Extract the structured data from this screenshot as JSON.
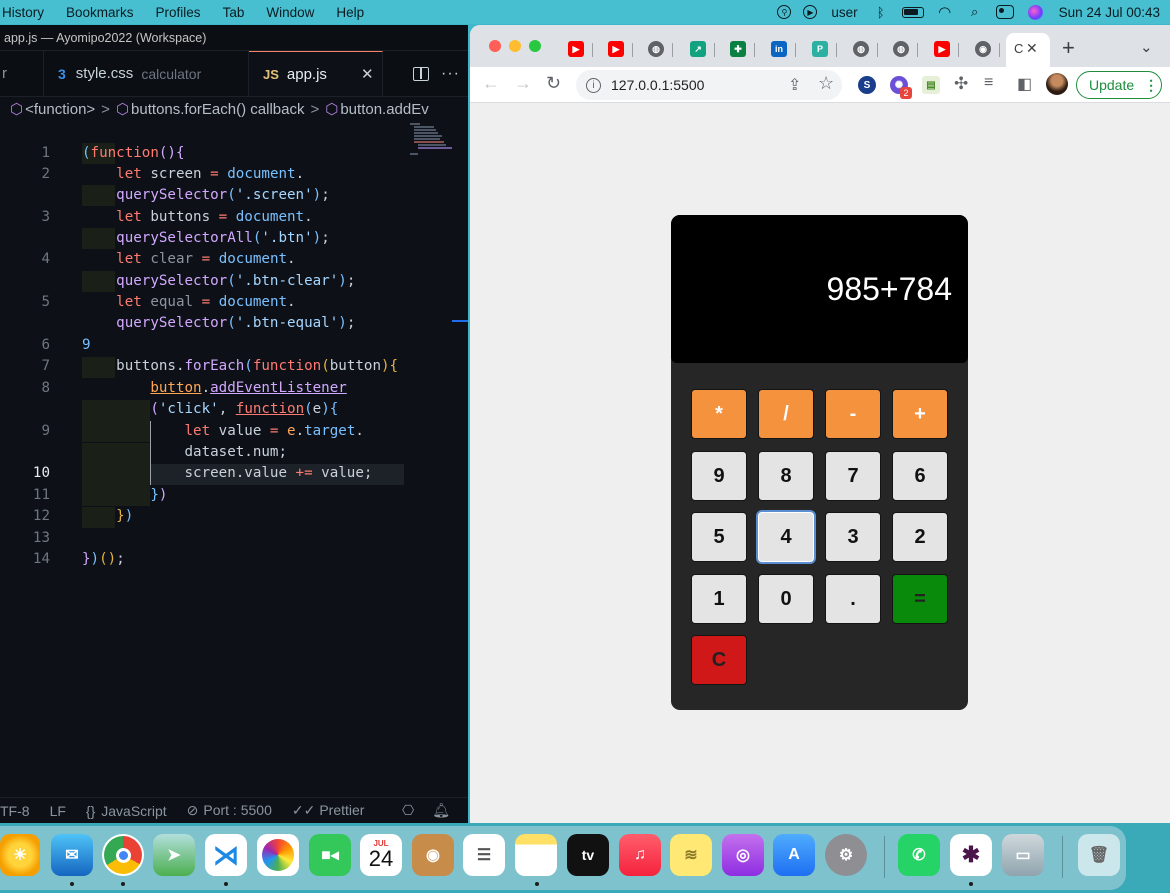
{
  "menubar": {
    "items": [
      "History",
      "Bookmarks",
      "Profiles",
      "Tab",
      "Window",
      "Help"
    ],
    "user": "user",
    "clock": "Sun 24 Jul  00:43"
  },
  "vscode": {
    "window_title": "app.js — Ayomipo2022 (Workspace)",
    "tabs": {
      "cut_label": "r",
      "css_icon": "3",
      "css_name": "style.css",
      "css_desc": "calculator",
      "js_icon": "JS",
      "js_name": "app.js",
      "close": "✕"
    },
    "breadcrumb": [
      "<function>",
      "buttons.forEach() callback",
      "button.addEv"
    ],
    "lines": {
      "n1": "1",
      "n2": "2",
      "n3": "3",
      "n4": "4",
      "n5": "5",
      "n6": "6",
      "n7": "7",
      "n8": "8",
      "n9": "9",
      "n10": "10",
      "n11": "11",
      "n12": "12",
      "n13": "13",
      "n14": "14"
    },
    "statusbar": {
      "encoding": "TF-8",
      "eol": "LF",
      "language": "JavaScript",
      "language_icon": "{}",
      "port": "Port : 5500",
      "prettier": "Prettier"
    }
  },
  "chrome": {
    "url": "127.0.0.1:5500",
    "update_label": "Update",
    "ext_badge": "2",
    "tab_title": "C"
  },
  "calculator": {
    "display": "985+784",
    "row1": [
      "*",
      "/",
      "-",
      "+"
    ],
    "row2": [
      "9",
      "8",
      "7",
      "6"
    ],
    "row3": [
      "5",
      "4",
      "3",
      "2"
    ],
    "row4": [
      "1",
      "0",
      ".",
      "="
    ],
    "clear": "C"
  },
  "dock": {
    "calendar_month": "JUL",
    "calendar_day": "24",
    "tv_label": "tv"
  },
  "colors": {
    "operator": "#f5923e",
    "equal": "#0a8a0a",
    "clear": "#d01818",
    "screen": "#000000"
  }
}
